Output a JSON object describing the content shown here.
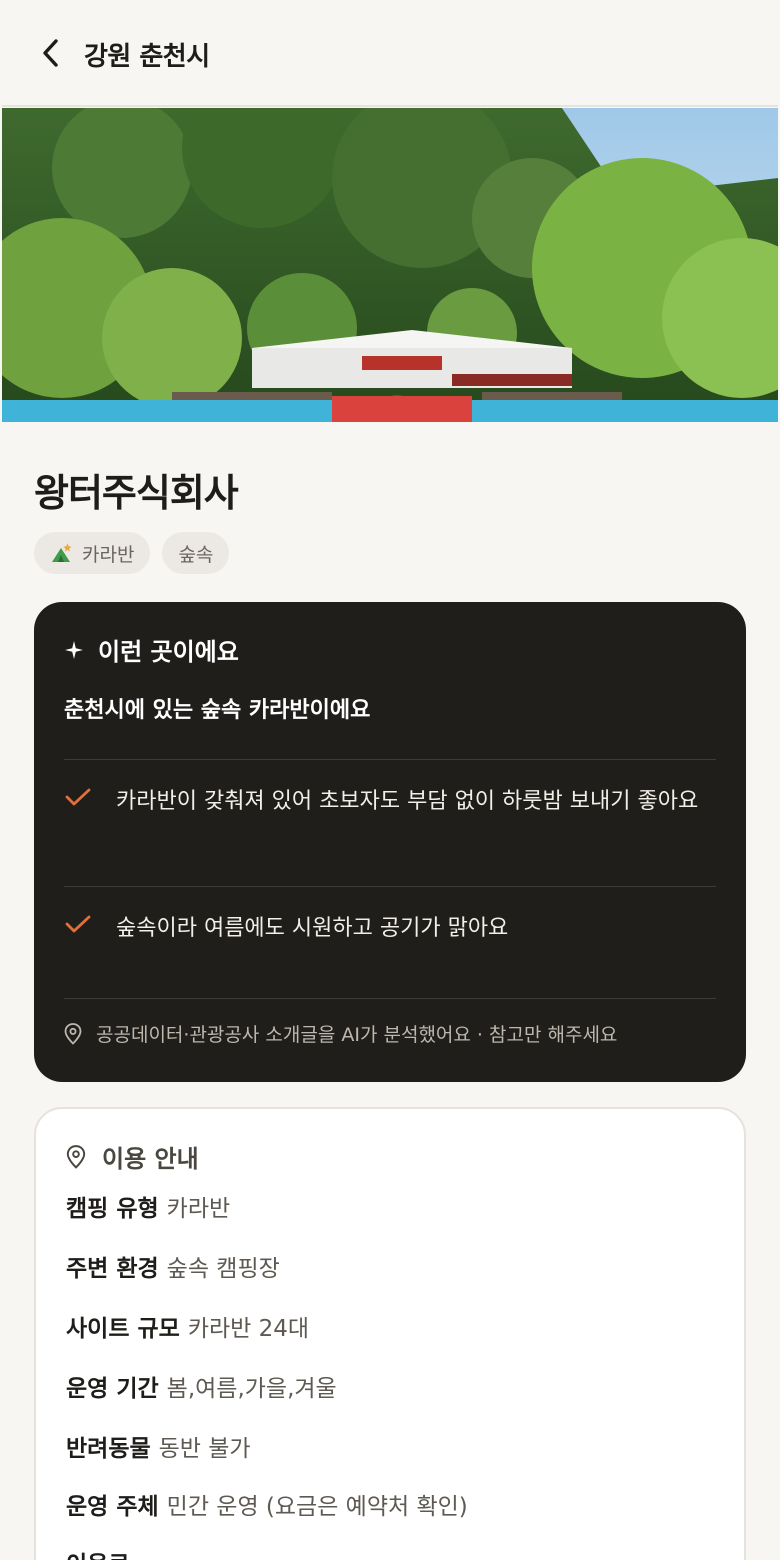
{
  "header": {
    "title": "강원 춘천시"
  },
  "place": {
    "name": "왕터주식회사",
    "tags": [
      {
        "label": "카라반",
        "icon": "camp-tent-icon"
      },
      {
        "label": "숲속"
      }
    ]
  },
  "ai_card": {
    "heading": "이런 곳이에요",
    "summary": "춘천시에 있는 숲속 카라반이에요",
    "points": [
      "카라반이 갖춰져 있어 초보자도 부담 없이 하룻밤 보내기 좋아요",
      "숲속이라 여름에도 시원하고 공기가 맑아요"
    ],
    "note": "공공데이터·관광공사 소개글을 AI가 분석했어요 · 참고만 해주세요"
  },
  "info": {
    "heading": "이용 안내",
    "rows": [
      {
        "key": "캠핑 유형",
        "value": "카라반"
      },
      {
        "key": "주변 환경",
        "value": "숲속 캠핑장"
      },
      {
        "key": "사이트 규모",
        "value": "카라반 24대"
      },
      {
        "key": "운영 기간",
        "value": "봄,여름,가을,겨울"
      },
      {
        "key": "반려동물",
        "value": "동반 불가"
      },
      {
        "key": "운영 주체",
        "value": "민간 운영 (요금은 예약처 확인)"
      },
      {
        "key": "이용료",
        "value": ""
      }
    ]
  },
  "colors": {
    "background": "#f8f6f2",
    "dark_card": "#201e1b",
    "accent": "#e2703a",
    "tag_bg": "#ece9e4"
  }
}
